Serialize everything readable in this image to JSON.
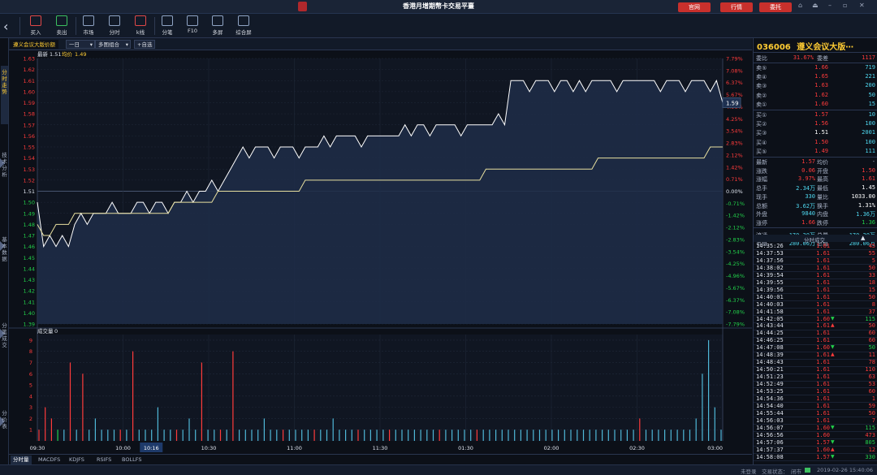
{
  "titlebar": {
    "title": "香港月增期幣卡交易平臺",
    "buttons": [
      "官网",
      "行情",
      "委托"
    ],
    "window_controls": [
      "⌂",
      "⏏",
      "–",
      "▫",
      "✕"
    ]
  },
  "toolbar": {
    "tools": [
      {
        "label": "买入",
        "icon": "buy-icon"
      },
      {
        "label": "卖出",
        "icon": "sell-icon"
      },
      {
        "label": "市场",
        "icon": "market-icon"
      },
      {
        "label": "分时",
        "icon": "timeshare-icon"
      },
      {
        "label": "k线",
        "icon": "kline-icon"
      },
      {
        "label": "分笔",
        "icon": "tick-icon"
      },
      {
        "label": "F10",
        "icon": "f10-icon"
      },
      {
        "label": "多屏",
        "icon": "multiscreen-icon"
      },
      {
        "label": "综合屏",
        "icon": "dashboard-icon"
      }
    ]
  },
  "left_rail": [
    "分时走势",
    "技术分析",
    "基本数据",
    "分笔成交",
    "分价表"
  ],
  "chart_tabs": {
    "stock_name": "遵义会议大版价额",
    "period": "一日",
    "combo": "多图组合",
    "add": "+自选"
  },
  "chart_data": {
    "type": "line",
    "price_header": {
      "latest_label": "最新",
      "latest": "1.51",
      "avg_label": "均价",
      "avg": "1.49"
    },
    "volume_header": {
      "label": "成交量",
      "value": "0"
    },
    "price_ticks": [
      "1.63",
      "1.62",
      "1.61",
      "1.60",
      "1.59",
      "1.58",
      "1.57",
      "1.56",
      "1.55",
      "1.54",
      "1.53",
      "1.52",
      "1.51",
      "1.50",
      "1.49",
      "1.48",
      "1.47",
      "1.46",
      "1.45",
      "1.44",
      "1.43",
      "1.42",
      "1.41",
      "1.40",
      "1.39"
    ],
    "pct_ticks": [
      "7.79%",
      "7.08%",
      "6.37%",
      "5.67%",
      "4.96%",
      "4.25%",
      "3.54%",
      "2.83%",
      "2.12%",
      "1.42%",
      "0.71%",
      "0.00%",
      "-0.71%",
      "-1.42%",
      "-2.12%",
      "-2.83%",
      "-3.54%",
      "-4.25%",
      "-4.96%",
      "-5.67%",
      "-6.37%",
      "-7.08%",
      "-7.79%"
    ],
    "ylim": [
      1.39,
      1.63
    ],
    "prev_close": 1.51,
    "current_marker": "1.59",
    "volume_ticks": [
      "9",
      "8",
      "7",
      "6",
      "5",
      "4",
      "3",
      "2",
      "1"
    ],
    "volume_ylim": [
      0,
      9.5
    ],
    "time_ticks": [
      "09:30",
      "10:00",
      "10:16",
      "10:30",
      "11:00",
      "11:30",
      "01:30",
      "02:00",
      "02:30",
      "03:00"
    ],
    "cursor_time": "10:16",
    "price_series": [
      1.5,
      1.46,
      1.47,
      1.46,
      1.47,
      1.46,
      1.48,
      1.49,
      1.48,
      1.49,
      1.49,
      1.49,
      1.5,
      1.49,
      1.49,
      1.49,
      1.5,
      1.5,
      1.49,
      1.5,
      1.5,
      1.49,
      1.5,
      1.5,
      1.51,
      1.5,
      1.51,
      1.51,
      1.52,
      1.51,
      1.52,
      1.53,
      1.54,
      1.55,
      1.54,
      1.55,
      1.55,
      1.55,
      1.54,
      1.55,
      1.55,
      1.55,
      1.54,
      1.55,
      1.55,
      1.55,
      1.56,
      1.55,
      1.56,
      1.56,
      1.56,
      1.56,
      1.55,
      1.56,
      1.56,
      1.56,
      1.56,
      1.56,
      1.56,
      1.57,
      1.56,
      1.57,
      1.57,
      1.56,
      1.57,
      1.57,
      1.57,
      1.57,
      1.56,
      1.57,
      1.57,
      1.57,
      1.57,
      1.57,
      1.58,
      1.57,
      1.61,
      1.61,
      1.61,
      1.6,
      1.61,
      1.61,
      1.61,
      1.6,
      1.61,
      1.61,
      1.6,
      1.61,
      1.6,
      1.61,
      1.61,
      1.61,
      1.61,
      1.6,
      1.61,
      1.61,
      1.61,
      1.61,
      1.61,
      1.61,
      1.6,
      1.61,
      1.61,
      1.61,
      1.6,
      1.61,
      1.61,
      1.61,
      1.6,
      1.61,
      1.59
    ],
    "avg_series": [
      1.48,
      1.47,
      1.47,
      1.48,
      1.48,
      1.48,
      1.49,
      1.49,
      1.49,
      1.49,
      1.49,
      1.49,
      1.49,
      1.49,
      1.49,
      1.49,
      1.49,
      1.49,
      1.49,
      1.49,
      1.49,
      1.49,
      1.5,
      1.5,
      1.5,
      1.5,
      1.5,
      1.5,
      1.5,
      1.51,
      1.51,
      1.51,
      1.51,
      1.51,
      1.51,
      1.51,
      1.51,
      1.51,
      1.51,
      1.51,
      1.51,
      1.51,
      1.51,
      1.52,
      1.52,
      1.52,
      1.52,
      1.52,
      1.52,
      1.52,
      1.52,
      1.52,
      1.52,
      1.52,
      1.52,
      1.52,
      1.52,
      1.52,
      1.52,
      1.52,
      1.52,
      1.52,
      1.52,
      1.52,
      1.52,
      1.52,
      1.52,
      1.52,
      1.52,
      1.52,
      1.52,
      1.52,
      1.53,
      1.53,
      1.53,
      1.53,
      1.53,
      1.53,
      1.53,
      1.53,
      1.53,
      1.53,
      1.53,
      1.53,
      1.53,
      1.53,
      1.53,
      1.53,
      1.53,
      1.53,
      1.54,
      1.54,
      1.54,
      1.54,
      1.54,
      1.54,
      1.54,
      1.54,
      1.54,
      1.54,
      1.54,
      1.54,
      1.54,
      1.54,
      1.54,
      1.54,
      1.54,
      1.54,
      1.55,
      1.55,
      1.55
    ],
    "volume_bars": [
      {
        "v": 1,
        "c": "r"
      },
      {
        "v": 3,
        "c": "r"
      },
      {
        "v": 2,
        "c": "r"
      },
      {
        "v": 1,
        "c": "g"
      },
      {
        "v": 1,
        "c": "b"
      },
      {
        "v": 7,
        "c": "r"
      },
      {
        "v": 1,
        "c": "b"
      },
      {
        "v": 6,
        "c": "r"
      },
      {
        "v": 1,
        "c": "b"
      },
      {
        "v": 2,
        "c": "b"
      },
      {
        "v": 1,
        "c": "b"
      },
      {
        "v": 1,
        "c": "b"
      },
      {
        "v": 1,
        "c": "b"
      },
      {
        "v": 1,
        "c": "r"
      },
      {
        "v": 1,
        "c": "b"
      },
      {
        "v": 8,
        "c": "r"
      },
      {
        "v": 1,
        "c": "b"
      },
      {
        "v": 1,
        "c": "b"
      },
      {
        "v": 1,
        "c": "b"
      },
      {
        "v": 3,
        "c": "b"
      },
      {
        "v": 1,
        "c": "b"
      },
      {
        "v": 1,
        "c": "b"
      },
      {
        "v": 1,
        "c": "r"
      },
      {
        "v": 1,
        "c": "b"
      },
      {
        "v": 2,
        "c": "b"
      },
      {
        "v": 1,
        "c": "b"
      },
      {
        "v": 7,
        "c": "r"
      },
      {
        "v": 1,
        "c": "b"
      },
      {
        "v": 1,
        "c": "b"
      },
      {
        "v": 1,
        "c": "r"
      },
      {
        "v": 1,
        "c": "b"
      },
      {
        "v": 8,
        "c": "r"
      },
      {
        "v": 1,
        "c": "b"
      },
      {
        "v": 1,
        "c": "b"
      },
      {
        "v": 1,
        "c": "b"
      },
      {
        "v": 1,
        "c": "b"
      },
      {
        "v": 2,
        "c": "b"
      },
      {
        "v": 1,
        "c": "b"
      },
      {
        "v": 1,
        "c": "b"
      },
      {
        "v": 1,
        "c": "r"
      },
      {
        "v": 1,
        "c": "b"
      },
      {
        "v": 1,
        "c": "b"
      },
      {
        "v": 1,
        "c": "b"
      },
      {
        "v": 1,
        "c": "b"
      },
      {
        "v": 1,
        "c": "r"
      },
      {
        "v": 1,
        "c": "b"
      },
      {
        "v": 1,
        "c": "b"
      },
      {
        "v": 2,
        "c": "b"
      },
      {
        "v": 1,
        "c": "b"
      },
      {
        "v": 1,
        "c": "b"
      },
      {
        "v": 1,
        "c": "b"
      },
      {
        "v": 1,
        "c": "r"
      },
      {
        "v": 1,
        "c": "b"
      },
      {
        "v": 1,
        "c": "b"
      },
      {
        "v": 1,
        "c": "b"
      },
      {
        "v": 1,
        "c": "b"
      },
      {
        "v": 1,
        "c": "r"
      },
      {
        "v": 1,
        "c": "b"
      },
      {
        "v": 1,
        "c": "b"
      },
      {
        "v": 1,
        "c": "b"
      },
      {
        "v": 1,
        "c": "b"
      },
      {
        "v": 1,
        "c": "b"
      },
      {
        "v": 1,
        "c": "b"
      },
      {
        "v": 1,
        "c": "b"
      },
      {
        "v": 1,
        "c": "r"
      },
      {
        "v": 1,
        "c": "b"
      },
      {
        "v": 1,
        "c": "b"
      },
      {
        "v": 1,
        "c": "b"
      },
      {
        "v": 1,
        "c": "b"
      },
      {
        "v": 1,
        "c": "b"
      },
      {
        "v": 1,
        "c": "r"
      },
      {
        "v": 1,
        "c": "b"
      },
      {
        "v": 1,
        "c": "b"
      },
      {
        "v": 1,
        "c": "b"
      },
      {
        "v": 1,
        "c": "b"
      },
      {
        "v": 1,
        "c": "b"
      },
      {
        "v": 1,
        "c": "b"
      },
      {
        "v": 1,
        "c": "b"
      },
      {
        "v": 1,
        "c": "b"
      },
      {
        "v": 1,
        "c": "b"
      },
      {
        "v": 1,
        "c": "b"
      },
      {
        "v": 1,
        "c": "b"
      },
      {
        "v": 1,
        "c": "b"
      },
      {
        "v": 1,
        "c": "b"
      },
      {
        "v": 1,
        "c": "b"
      },
      {
        "v": 1,
        "c": "b"
      },
      {
        "v": 1,
        "c": "b"
      },
      {
        "v": 1,
        "c": "b"
      },
      {
        "v": 1,
        "c": "b"
      },
      {
        "v": 1,
        "c": "b"
      },
      {
        "v": 1,
        "c": "b"
      },
      {
        "v": 1,
        "c": "b"
      },
      {
        "v": 1,
        "c": "b"
      },
      {
        "v": 1,
        "c": "b"
      },
      {
        "v": 1,
        "c": "b"
      },
      {
        "v": 1,
        "c": "b"
      },
      {
        "v": 2,
        "c": "r"
      },
      {
        "v": 1,
        "c": "b"
      },
      {
        "v": 1,
        "c": "b"
      },
      {
        "v": 1,
        "c": "b"
      },
      {
        "v": 1,
        "c": "b"
      },
      {
        "v": 1,
        "c": "b"
      },
      {
        "v": 1,
        "c": "b"
      },
      {
        "v": 1,
        "c": "b"
      },
      {
        "v": 1,
        "c": "b"
      },
      {
        "v": 2,
        "c": "b"
      },
      {
        "v": 6,
        "c": "b"
      },
      {
        "v": 9,
        "c": "b"
      },
      {
        "v": 3,
        "c": "b"
      },
      {
        "v": 1,
        "c": "b"
      }
    ]
  },
  "quote": {
    "code": "036006",
    "name": "遵义会议大版⋯",
    "weibi": {
      "label": "委比",
      "value": "31.67%",
      "label2": "委差",
      "value2": "1117"
    },
    "asks": [
      {
        "label": "卖⑤",
        "price": "1.66",
        "vol": "719"
      },
      {
        "label": "卖④",
        "price": "1.65",
        "vol": "221"
      },
      {
        "label": "卖③",
        "price": "1.63",
        "vol": "200"
      },
      {
        "label": "卖②",
        "price": "1.62",
        "vol": "50"
      },
      {
        "label": "卖①",
        "price": "1.60",
        "vol": "15"
      }
    ],
    "bids": [
      {
        "label": "买①",
        "price": "1.57",
        "vol": "10"
      },
      {
        "label": "买②",
        "price": "1.56",
        "vol": "100"
      },
      {
        "label": "买③",
        "price": "1.51",
        "vol": "2001"
      },
      {
        "label": "买④",
        "price": "1.50",
        "vol": "100"
      },
      {
        "label": "买⑤",
        "price": "1.49",
        "vol": "111"
      }
    ],
    "stats": [
      {
        "l1": "最新",
        "v1": "1.57",
        "l2": "均价",
        "v2": "-"
      },
      {
        "l1": "涨跌",
        "v1": "0.06",
        "l2": "开盘",
        "v2": "1.50"
      },
      {
        "l1": "涨幅",
        "v1": "3.97%",
        "l2": "最高",
        "v2": "1.61"
      },
      {
        "l1": "总手",
        "v1": "2.34万",
        "l2": "最低",
        "v2": "1.45"
      },
      {
        "l1": "现手",
        "v1": "330",
        "l2": "量比",
        "v2": "1033.00"
      },
      {
        "l1": "总额",
        "v1": "3.62万",
        "l2": "换手",
        "v2": "1.31%"
      },
      {
        "l1": "外盘",
        "v1": "9840",
        "l2": "内盘",
        "v2": "1.36万"
      },
      {
        "l1": "涨停",
        "v1": "1.66",
        "l2": "跌停",
        "v2": "1.36"
      },
      {
        "l1": "流通",
        "v1": "170.30万",
        "l2": "总量",
        "v2": "170.30万"
      },
      {
        "l1": "市值",
        "v1": "280.06万",
        "l2": "总值",
        "v2": "280.06万"
      }
    ],
    "ticks_title": "分时成交",
    "ticks": [
      {
        "t": "14:35:26",
        "p": "1.61",
        "v": "45",
        "d": ""
      },
      {
        "t": "14:37:53",
        "p": "1.61",
        "v": "55",
        "d": ""
      },
      {
        "t": "14:37:56",
        "p": "1.61",
        "v": "5",
        "d": ""
      },
      {
        "t": "14:38:02",
        "p": "1.61",
        "v": "50",
        "d": ""
      },
      {
        "t": "14:39:54",
        "p": "1.61",
        "v": "33",
        "d": ""
      },
      {
        "t": "14:39:55",
        "p": "1.61",
        "v": "18",
        "d": ""
      },
      {
        "t": "14:39:56",
        "p": "1.61",
        "v": "15",
        "d": ""
      },
      {
        "t": "14:40:01",
        "p": "1.61",
        "v": "50",
        "d": ""
      },
      {
        "t": "14:40:03",
        "p": "1.61",
        "v": "8",
        "d": ""
      },
      {
        "t": "14:41:58",
        "p": "1.61",
        "v": "37",
        "d": ""
      },
      {
        "t": "14:42:05",
        "p": "1.60",
        "v": "115",
        "d": "▼"
      },
      {
        "t": "14:43:44",
        "p": "1.61",
        "v": "50",
        "d": "▲"
      },
      {
        "t": "14:44:25",
        "p": "1.61",
        "v": "60",
        "d": ""
      },
      {
        "t": "14:46:25",
        "p": "1.61",
        "v": "60",
        "d": ""
      },
      {
        "t": "14:47:08",
        "p": "1.60",
        "v": "50",
        "d": "▼"
      },
      {
        "t": "14:48:39",
        "p": "1.61",
        "v": "11",
        "d": "▲"
      },
      {
        "t": "14:48:43",
        "p": "1.61",
        "v": "78",
        "d": ""
      },
      {
        "t": "14:50:21",
        "p": "1.61",
        "v": "110",
        "d": ""
      },
      {
        "t": "14:51:23",
        "p": "1.61",
        "v": "63",
        "d": ""
      },
      {
        "t": "14:52:49",
        "p": "1.61",
        "v": "53",
        "d": ""
      },
      {
        "t": "14:53:25",
        "p": "1.61",
        "v": "60",
        "d": ""
      },
      {
        "t": "14:54:36",
        "p": "1.61",
        "v": "1",
        "d": ""
      },
      {
        "t": "14:54:40",
        "p": "1.61",
        "v": "59",
        "d": ""
      },
      {
        "t": "14:55:44",
        "p": "1.61",
        "v": "50",
        "d": ""
      },
      {
        "t": "14:56:03",
        "p": "1.61",
        "v": "7",
        "d": ""
      },
      {
        "t": "14:56:07",
        "p": "1.60",
        "v": "115",
        "d": "▼"
      },
      {
        "t": "14:56:56",
        "p": "1.60",
        "v": "473",
        "d": ""
      },
      {
        "t": "14:57:06",
        "p": "1.57",
        "v": "805",
        "d": "▼"
      },
      {
        "t": "14:57:37",
        "p": "1.60",
        "v": "12",
        "d": "▲"
      },
      {
        "t": "14:58:08",
        "p": "1.57",
        "v": "330",
        "d": "▼"
      }
    ]
  },
  "bottom_tabs": [
    "分时量",
    "MACDFS",
    "KDJFS",
    "RSIFS",
    "BOLLFS"
  ],
  "status": {
    "login": "未登录",
    "trade_label": "交易状态：",
    "trade_state": "闭市",
    "datetime": "2019-02-26 15:40:06"
  },
  "colors": {
    "up": "#ff3b3b",
    "down": "#22d04a",
    "accent": "#ffcc33",
    "price_line": "#ffffff",
    "avg_line": "#e8e0a0"
  }
}
